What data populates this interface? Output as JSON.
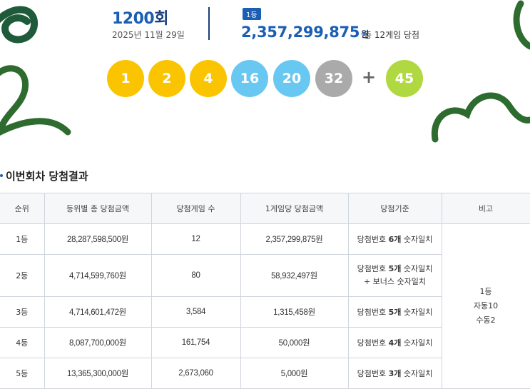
{
  "header": {
    "round_number": "1200",
    "round_unit": "회",
    "date": "2025년 11월 29일",
    "rank_badge": "1등",
    "first_prize_amount": "2,357,299,875",
    "first_prize_unit": "원",
    "winner_note": "총 12게임 당첨"
  },
  "numbers": [
    {
      "value": "1",
      "color": "#fbc400"
    },
    {
      "value": "2",
      "color": "#fbc400"
    },
    {
      "value": "4",
      "color": "#fbc400"
    },
    {
      "value": "16",
      "color": "#69c8f2"
    },
    {
      "value": "20",
      "color": "#69c8f2"
    },
    {
      "value": "32",
      "color": "#aaaaaa"
    }
  ],
  "plus_sign": "+",
  "bonus": {
    "value": "45",
    "color": "#b0d840"
  },
  "section_title": "이번회차 당첨결과",
  "table": {
    "headers": [
      "순위",
      "등위별 총 당첨금액",
      "당첨게임 수",
      "1게임당 당첨금액",
      "당첨기준",
      "비고"
    ],
    "rows": [
      {
        "rank": "1등",
        "total": "28,287,598,500원",
        "games": "12",
        "per_game": "2,357,299,875원",
        "criteria_pre": "당첨번호 ",
        "criteria_bold": "6개",
        "criteria_post": " 숫자일치",
        "criteria_line2": ""
      },
      {
        "rank": "2등",
        "total": "4,714,599,760원",
        "games": "80",
        "per_game": "58,932,497원",
        "criteria_pre": "당첨번호 ",
        "criteria_bold": "5개",
        "criteria_post": " 숫자일치",
        "criteria_line2": "+ 보너스 숫자일치"
      },
      {
        "rank": "3등",
        "total": "4,714,601,472원",
        "games": "3,584",
        "per_game": "1,315,458원",
        "criteria_pre": "당첨번호 ",
        "criteria_bold": "5개",
        "criteria_post": " 숫자일치",
        "criteria_line2": ""
      },
      {
        "rank": "4등",
        "total": "8,087,700,000원",
        "games": "161,754",
        "per_game": "50,000원",
        "criteria_pre": "당첨번호 ",
        "criteria_bold": "4개",
        "criteria_post": " 숫자일치",
        "criteria_line2": ""
      },
      {
        "rank": "5등",
        "total": "13,365,300,000원",
        "games": "2,673,060",
        "per_game": "5,000원",
        "criteria_pre": "당첨번호 ",
        "criteria_bold": "3개",
        "criteria_post": " 숫자일치",
        "criteria_line2": ""
      }
    ],
    "note": {
      "line1": "1등",
      "line2": "자동10",
      "line3": "수동2"
    }
  }
}
